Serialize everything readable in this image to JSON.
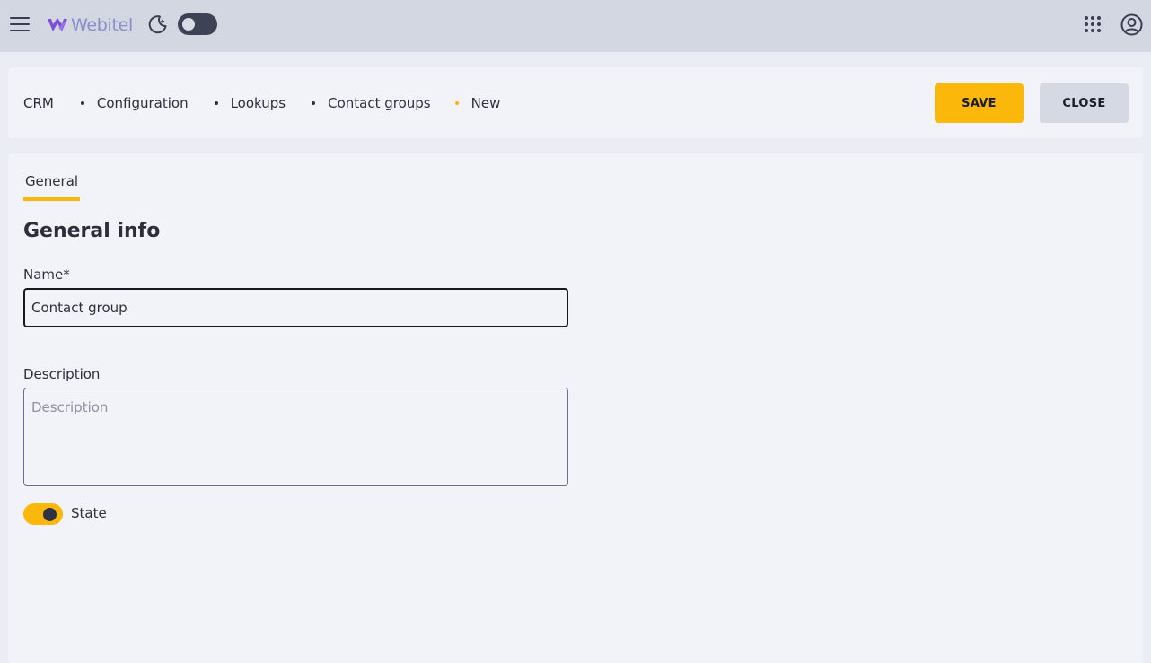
{
  "app": {
    "logo_text": "Webitel"
  },
  "icons": {
    "menu": "hamburger-icon",
    "theme": "moon-icon",
    "apps": "apps-grid-icon",
    "account": "account-icon"
  },
  "theme_toggle": {
    "dark_mode": false
  },
  "breadcrumb": {
    "items": [
      "CRM",
      "Configuration",
      "Lookups",
      "Contact groups",
      "New"
    ]
  },
  "actions": {
    "save_label": "SAVE",
    "close_label": "CLOSE"
  },
  "tabs": [
    {
      "label": "General",
      "active": true
    }
  ],
  "form": {
    "section_title": "General info",
    "name_label": "Name*",
    "name_value": "Contact group",
    "description_label": "Description",
    "description_placeholder": "Description",
    "description_value": "",
    "state_label": "State",
    "state_on": true
  },
  "colors": {
    "accent": "#fcb80a",
    "topbar": "#d3d7e2",
    "card": "#f2f3f8",
    "logo": "#8a8dc8"
  }
}
